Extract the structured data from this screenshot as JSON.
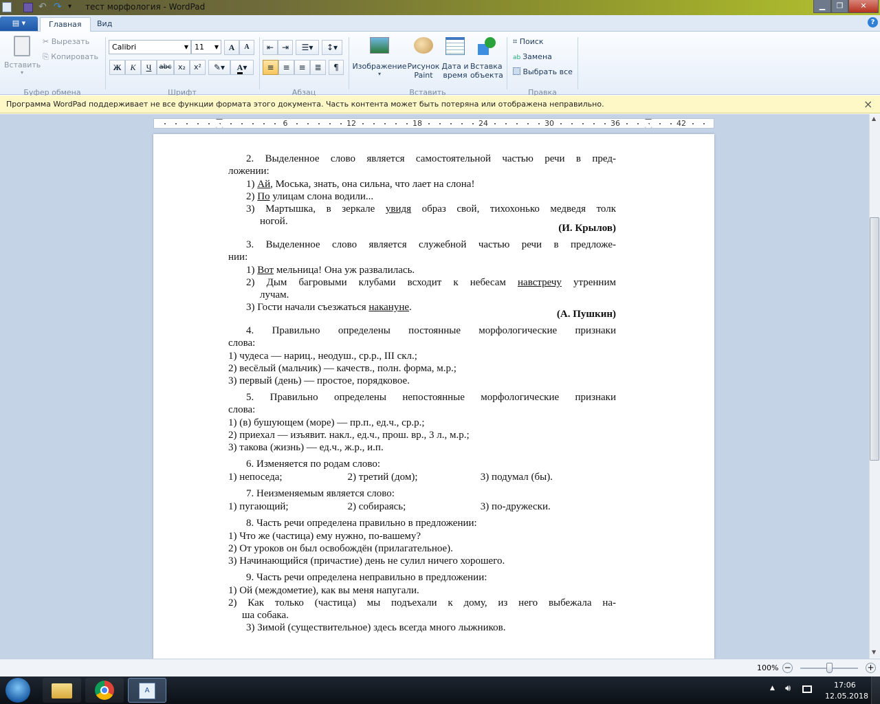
{
  "window": {
    "title": "тест морфология - WordPad"
  },
  "tabs": [
    {
      "label": "Главная"
    },
    {
      "label": "Вид"
    }
  ],
  "ribbon": {
    "clipboard": {
      "paste": "Вставить",
      "cut": "Вырезать",
      "copy": "Копировать",
      "group": "Буфер обмена"
    },
    "font": {
      "name": "Calibri",
      "size": "11",
      "bold": "Ж",
      "italic": "К",
      "underline": "Ч",
      "strike": "abc",
      "sub": "x₂",
      "sup": "x²",
      "group": "Шрифт"
    },
    "paragraph": {
      "group": "Абзац"
    },
    "insert": {
      "image": "Изображение",
      "paint": "Рисунок Paint",
      "datetime": "Дата и время",
      "object": "Вставка объекта",
      "group": "Вставить"
    },
    "edit": {
      "find": "Поиск",
      "replace": "Замена",
      "select_all": "Выбрать все",
      "group": "Правка"
    }
  },
  "infobar": {
    "message": "Программа WordPad поддерживает не все функции формата этого документа. Часть контента может быть потеряна или отображена неправильно.",
    "close": "×"
  },
  "ruler": {
    "labels": [
      "6",
      "12",
      "18",
      "24",
      "30",
      "36",
      "42"
    ]
  },
  "document": [
    {
      "lines": [
        {
          "kind": "heading-j",
          "segs": [
            {
              "t": "2. Выделенное слово является самостоятельной частью речи в пред-"
            }
          ]
        },
        {
          "kind": "plain",
          "segs": [
            {
              "t": "ложении:"
            }
          ]
        },
        {
          "kind": "item",
          "segs": [
            {
              "t": "1) "
            },
            {
              "t": "Ай",
              "u": true
            },
            {
              "t": ", Моська, знать, она сильна, что лает на слона!"
            }
          ]
        },
        {
          "kind": "item",
          "segs": [
            {
              "t": "2) "
            },
            {
              "t": "По",
              "u": true
            },
            {
              "t": " улицам слона водили..."
            }
          ]
        },
        {
          "kind": "item-j",
          "segs": [
            {
              "t": "3) Мартышка, в зеркале "
            },
            {
              "t": "увидя",
              "u": true
            },
            {
              "t": " образ свой, тихохонько медведя толк"
            }
          ]
        },
        {
          "kind": "cont",
          "segs": [
            {
              "t": "ногой."
            }
          ]
        },
        {
          "kind": "attr",
          "segs": [
            {
              "t": "(И. Крылов)"
            }
          ]
        }
      ]
    },
    {
      "lines": [
        {
          "kind": "heading-j",
          "segs": [
            {
              "t": "3. Выделенное слово является служебной частью речи в предложе-"
            }
          ]
        },
        {
          "kind": "plain",
          "segs": [
            {
              "t": "нии:"
            }
          ]
        },
        {
          "kind": "item",
          "segs": [
            {
              "t": "1) "
            },
            {
              "t": "Вот",
              "u": true
            },
            {
              "t": " мельница! Она уж развалилась."
            }
          ]
        },
        {
          "kind": "item-j",
          "segs": [
            {
              "t": "2) Дым багровыми клубами всходит к небесам "
            },
            {
              "t": "навстречу",
              "u": true
            },
            {
              "t": " утренним"
            }
          ]
        },
        {
          "kind": "cont",
          "segs": [
            {
              "t": "лучам."
            }
          ]
        },
        {
          "kind": "item",
          "segs": [
            {
              "t": "3) Гости начали съезжаться "
            },
            {
              "t": "накануне",
              "u": true
            },
            {
              "t": "."
            }
          ]
        },
        {
          "kind": "attr",
          "segs": [
            {
              "t": "(А. Пушкин)"
            }
          ]
        }
      ]
    },
    {
      "lines": [
        {
          "kind": "heading-j",
          "segs": [
            {
              "t": "4. Правильно определены постоянные морфологические признаки"
            }
          ]
        },
        {
          "kind": "plain",
          "segs": [
            {
              "t": "слова:"
            }
          ]
        },
        {
          "kind": "item2",
          "segs": [
            {
              "t": "1) чудеса — нариц., неодуш., ср.р., III скл.;"
            }
          ]
        },
        {
          "kind": "item2",
          "segs": [
            {
              "t": "2) весёлый (мальчик) — качеств., полн. форма, м.р.;"
            }
          ]
        },
        {
          "kind": "item2",
          "segs": [
            {
              "t": "3) первый (день) — простое, порядковое."
            }
          ]
        }
      ]
    },
    {
      "lines": [
        {
          "kind": "heading-j",
          "segs": [
            {
              "t": "5. Правильно определены непостоянные морфологические признаки"
            }
          ]
        },
        {
          "kind": "plain",
          "segs": [
            {
              "t": "слова:"
            }
          ]
        },
        {
          "kind": "item2",
          "segs": [
            {
              "t": "1) (в) бушующем (море) — пр.п., ед.ч., ср.р.;"
            }
          ]
        },
        {
          "kind": "item2",
          "segs": [
            {
              "t": "2) приехал — изъявит. накл., ед.ч., прош. вр., 3 л., м.р.;"
            }
          ]
        },
        {
          "kind": "item2",
          "segs": [
            {
              "t": "3) такова (жизнь) — ед.ч., ж.р., и.п."
            }
          ]
        }
      ]
    },
    {
      "lines": [
        {
          "kind": "heading",
          "segs": [
            {
              "t": "6. Изменяется по родам слово:"
            }
          ]
        },
        {
          "kind": "cols",
          "segs": [
            {
              "t": "1) непоседа;"
            },
            {
              "t": "2) третий (дом);"
            },
            {
              "t": "3) подумал (бы)."
            }
          ]
        }
      ]
    },
    {
      "lines": [
        {
          "kind": "heading",
          "segs": [
            {
              "t": "7. Неизменяемым является слово:"
            }
          ]
        },
        {
          "kind": "cols",
          "segs": [
            {
              "t": "1) пугающий;"
            },
            {
              "t": "2) собираясь;"
            },
            {
              "t": "3) по-дружески."
            }
          ]
        }
      ]
    },
    {
      "lines": [
        {
          "kind": "heading",
          "segs": [
            {
              "t": "8. Часть речи определена правильно в предложении:"
            }
          ]
        },
        {
          "kind": "item2",
          "segs": [
            {
              "t": "1) Что же (частица) ему нужно, по-вашему?"
            }
          ]
        },
        {
          "kind": "item2",
          "segs": [
            {
              "t": "2) От уроков он был освобождён (прилагательное)."
            }
          ]
        },
        {
          "kind": "item2",
          "segs": [
            {
              "t": "3) Начинающийся (причастие) день не сулил ничего хорошего."
            }
          ]
        }
      ]
    },
    {
      "lines": [
        {
          "kind": "heading",
          "segs": [
            {
              "t": "9. Часть речи определена неправильно в предложении:"
            }
          ]
        },
        {
          "kind": "item2",
          "segs": [
            {
              "t": "1) Ой (междометие), как вы меня напугали."
            }
          ]
        },
        {
          "kind": "item2j",
          "segs": [
            {
              "t": "2) Как только (частица) мы подъехали к дому, из него выбежала на-"
            }
          ]
        },
        {
          "kind": "cont2",
          "segs": [
            {
              "t": "ша собака."
            }
          ]
        },
        {
          "kind": "item",
          "segs": [
            {
              "t": "3) Зимой (существительное) здесь всегда много лыжников."
            }
          ]
        }
      ]
    }
  ],
  "status": {
    "zoom": "100%"
  },
  "taskbar": {
    "time": "17:06",
    "date": "12.05.2018"
  }
}
